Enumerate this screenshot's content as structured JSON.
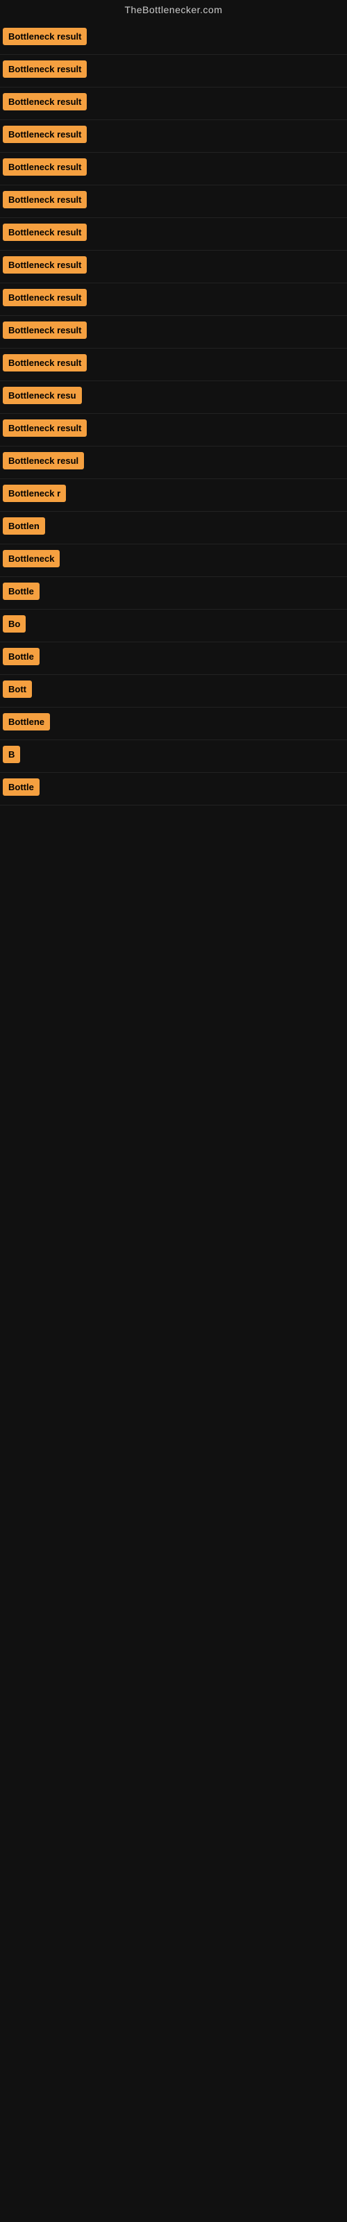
{
  "site": {
    "title": "TheBottlenecker.com"
  },
  "rows": [
    {
      "id": 1,
      "label": "Bottleneck result",
      "visible_text": "Bottleneck result"
    },
    {
      "id": 2,
      "label": "Bottleneck result",
      "visible_text": "Bottleneck result"
    },
    {
      "id": 3,
      "label": "Bottleneck result",
      "visible_text": "Bottleneck result"
    },
    {
      "id": 4,
      "label": "Bottleneck result",
      "visible_text": "Bottleneck result"
    },
    {
      "id": 5,
      "label": "Bottleneck result",
      "visible_text": "Bottleneck result"
    },
    {
      "id": 6,
      "label": "Bottleneck result",
      "visible_text": "Bottleneck result"
    },
    {
      "id": 7,
      "label": "Bottleneck result",
      "visible_text": "Bottleneck result"
    },
    {
      "id": 8,
      "label": "Bottleneck result",
      "visible_text": "Bottleneck result"
    },
    {
      "id": 9,
      "label": "Bottleneck result",
      "visible_text": "Bottleneck result"
    },
    {
      "id": 10,
      "label": "Bottleneck result",
      "visible_text": "Bottleneck result"
    },
    {
      "id": 11,
      "label": "Bottleneck result",
      "visible_text": "Bottleneck result"
    },
    {
      "id": 12,
      "label": "Bottleneck resu",
      "visible_text": "Bottleneck resu"
    },
    {
      "id": 13,
      "label": "Bottleneck result",
      "visible_text": "Bottleneck result"
    },
    {
      "id": 14,
      "label": "Bottleneck resul",
      "visible_text": "Bottleneck resul"
    },
    {
      "id": 15,
      "label": "Bottleneck r",
      "visible_text": "Bottleneck r"
    },
    {
      "id": 16,
      "label": "Bottlen",
      "visible_text": "Bottlen"
    },
    {
      "id": 17,
      "label": "Bottleneck",
      "visible_text": "Bottleneck"
    },
    {
      "id": 18,
      "label": "Bottle",
      "visible_text": "Bottle"
    },
    {
      "id": 19,
      "label": "Bo",
      "visible_text": "Bo"
    },
    {
      "id": 20,
      "label": "Bottle",
      "visible_text": "Bottle"
    },
    {
      "id": 21,
      "label": "Bott",
      "visible_text": "Bott"
    },
    {
      "id": 22,
      "label": "Bottlene",
      "visible_text": "Bottlene"
    },
    {
      "id": 23,
      "label": "B",
      "visible_text": "B"
    },
    {
      "id": 24,
      "label": "Bottle",
      "visible_text": "Bottle"
    }
  ]
}
